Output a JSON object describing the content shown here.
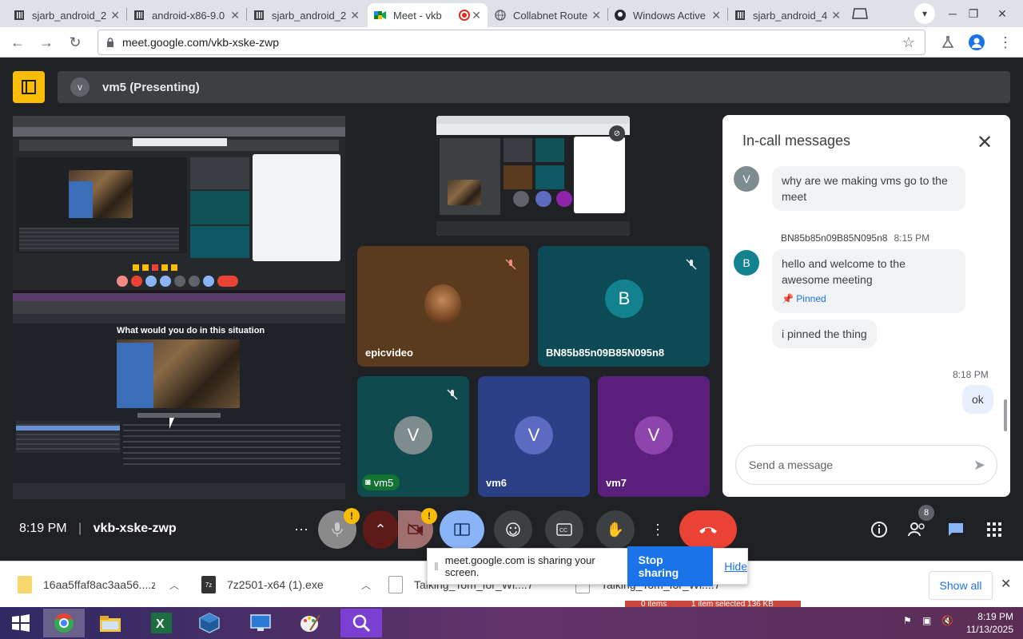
{
  "browser": {
    "tabs": [
      {
        "title": "sjarb_android_2",
        "icon": "sourceforge-icon"
      },
      {
        "title": "android-x86-9.0",
        "icon": "sourceforge-icon"
      },
      {
        "title": "sjarb_android_2",
        "icon": "sourceforge-icon"
      },
      {
        "title": "Meet - vkb",
        "icon": "meet-icon",
        "active": true
      },
      {
        "title": "Collabnet Route",
        "icon": "globe-icon"
      },
      {
        "title": "Windows Active",
        "icon": "github-icon"
      },
      {
        "title": "sjarb_android_4",
        "icon": "sourceforge-icon"
      }
    ],
    "url": "meet.google.com/vkb-xske-zwp"
  },
  "meet": {
    "presenter_initial": "v",
    "presenting_label": "vm5 (Presenting)",
    "shared_screen_caption": "What would you do in this situation",
    "participants": [
      {
        "name": "epicvideo",
        "muted": true
      },
      {
        "name": "BN85b85n09B85N095n8",
        "initial": "B",
        "muted": true
      },
      {
        "name": "vm5",
        "initial": "V",
        "muted": true
      },
      {
        "name": "vm6",
        "initial": "V"
      },
      {
        "name": "vm7",
        "initial": "V"
      }
    ],
    "meeting_time": "8:19 PM",
    "meeting_code": "vkb-xske-zwp",
    "participant_count": "8",
    "warning_glyph": "!",
    "colors": {
      "accent": "#1a73e8",
      "logo": "#fbbc04",
      "end_call": "#ea4335",
      "present": "#8ab4f8"
    }
  },
  "chat": {
    "title": "In-call messages",
    "messages": [
      {
        "initial": "V",
        "text": "why are we making vms go to the meet"
      },
      {
        "sender": "BN85b85n09B85N095n8",
        "time": "8:15 PM",
        "initial": "B",
        "text": "hello and welcome to the awesome meeting",
        "pinned": "Pinned"
      },
      {
        "text": "i pinned the thing"
      },
      {
        "time": "8:18 PM",
        "text": "ok"
      }
    ],
    "placeholder": "Send a message"
  },
  "sharing": {
    "text": "meet.google.com is sharing your screen.",
    "stop_label": "Stop sharing",
    "hide_label": "Hide"
  },
  "downloads": {
    "items": [
      {
        "name": "16aa5ffaf8ac3aa56....zip"
      },
      {
        "name": "7z2501-x64 (1).exe"
      },
      {
        "name": "Talking_Tom_for_Wi....72"
      },
      {
        "name": "Talking_Tom_for_Wi....72"
      }
    ],
    "show_all": "Show all"
  },
  "behind_text": {
    "items": "0 items",
    "selected": "1 item selected 136 KB"
  },
  "taskbar": {
    "time": "8:19 PM",
    "date": "11/13/2025"
  }
}
